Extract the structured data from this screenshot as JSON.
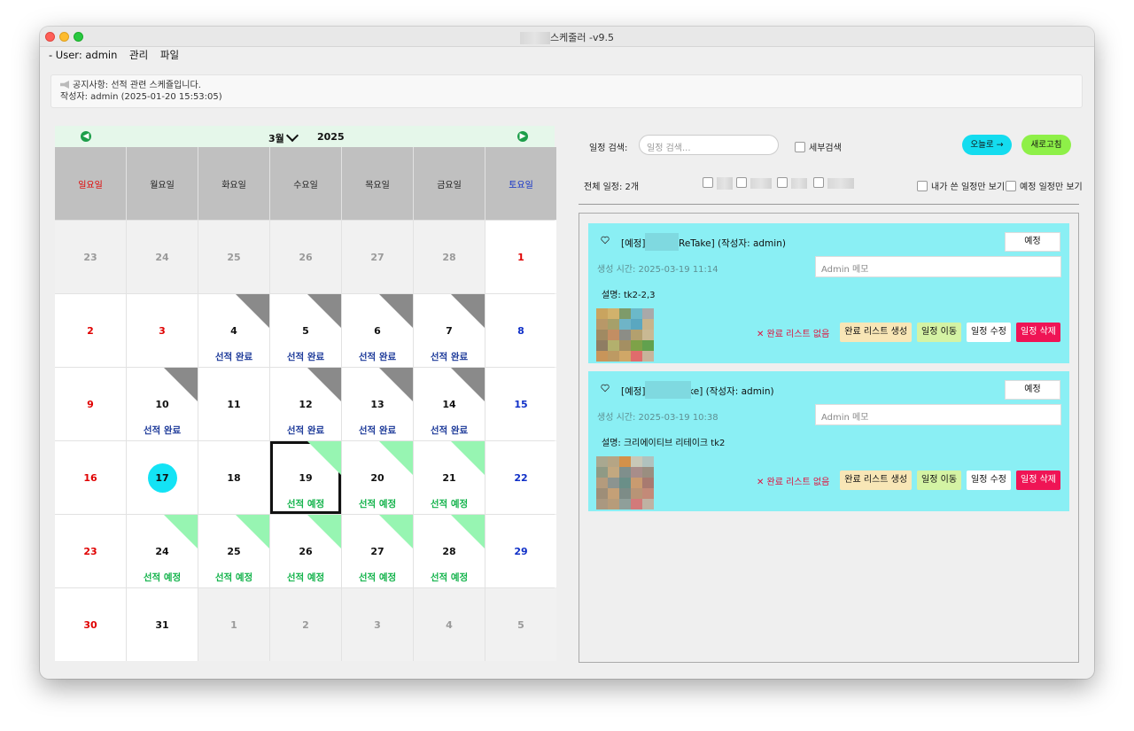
{
  "window": {
    "title": "스케줄러 -v9.5"
  },
  "menu": {
    "user": "- User: admin",
    "manage": "관리",
    "file": "파일"
  },
  "notice": {
    "line1": "공지사항: 선적 관련 스케쥴입니다.",
    "line2": "작성자: admin (2025-01-20 15:53:05)"
  },
  "calendar": {
    "month": "3월",
    "year": "2025",
    "weekdays": [
      "일요일",
      "월요일",
      "화요일",
      "수요일",
      "목요일",
      "금요일",
      "토요일"
    ],
    "days": [
      "23",
      "24",
      "25",
      "26",
      "27",
      "28",
      "1",
      "2",
      "3",
      "4",
      "5",
      "6",
      "7",
      "8",
      "9",
      "10",
      "11",
      "12",
      "13",
      "14",
      "15",
      "16",
      "17",
      "18",
      "19",
      "20",
      "21",
      "22",
      "23",
      "24",
      "25",
      "26",
      "27",
      "28",
      "29",
      "30",
      "31",
      "1",
      "2",
      "3",
      "4",
      "5"
    ],
    "label_done": "선적 완료",
    "label_plan": "선적 예정"
  },
  "toolbar": {
    "search_label": "일정 검색:",
    "search_placeholder": "일정 검색...",
    "detail_search": "세부검색",
    "today_button": "오늘로 →",
    "refresh_button": "새로고침",
    "total": "전체 일정: 2개",
    "mine_only": "내가 쓴 일정만 보기",
    "planned_only": "예정 일정만 보기"
  },
  "cards": [
    {
      "head": "[예정]       1506 [ReTake] (작성자: admin)",
      "status": "예정",
      "time": "생성 시간: 2025-03-19 11:14",
      "memo_placeholder": "Admin 메모",
      "desc": "설명: tk2-2,3"
    },
    {
      "head": "[예정]           12 [ReTake] (작성자: admin)",
      "status": "예정",
      "time": "생성 시간: 2025-03-19 10:38",
      "memo_placeholder": "Admin 메모",
      "desc": "설명: 크리에이티브 리테이크 tk2"
    }
  ],
  "card_actions": {
    "none": "✕ 완료 리스트 없음",
    "create": "완료 리스트 생성",
    "move": "일정 이동",
    "edit": "일정 수정",
    "delete": "일정 삭제"
  }
}
